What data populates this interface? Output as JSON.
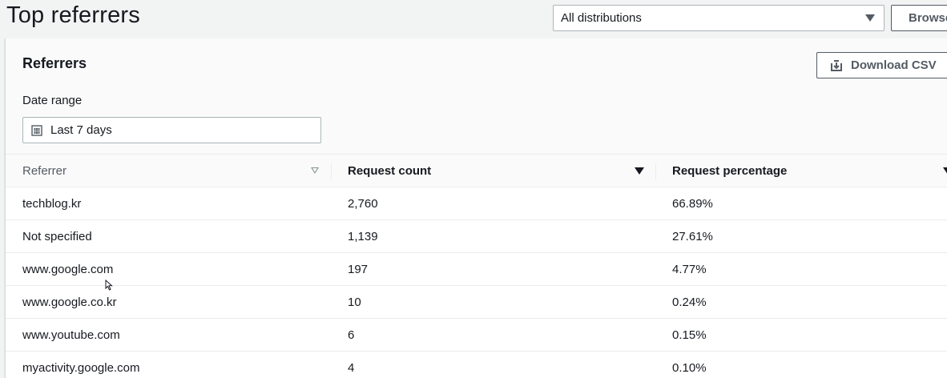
{
  "header": {
    "title": "Top referrers",
    "distribution_select": "All distributions",
    "browse_button": "Browse"
  },
  "panel": {
    "title": "Referrers",
    "download_button": "Download CSV",
    "date_range_label": "Date range",
    "date_range_value": "Last 7 days"
  },
  "table": {
    "columns": [
      "Referrer",
      "Request count",
      "Request percentage"
    ],
    "sorted_column": "Request count",
    "rows": [
      {
        "referrer": "techblog.kr",
        "count": "2,760",
        "percentage": "66.89%"
      },
      {
        "referrer": "Not specified",
        "count": "1,139",
        "percentage": "27.61%"
      },
      {
        "referrer": "www.google.com",
        "count": "197",
        "percentage": "4.77%"
      },
      {
        "referrer": "www.google.co.kr",
        "count": "10",
        "percentage": "0.24%"
      },
      {
        "referrer": "www.youtube.com",
        "count": "6",
        "percentage": "0.15%"
      },
      {
        "referrer": "myactivity.google.com",
        "count": "4",
        "percentage": "0.10%"
      }
    ]
  },
  "icons": [
    "calendar-icon",
    "download-icon",
    "caret-down-icon",
    "sort-icon",
    "mouse-cursor-icon"
  ],
  "colors": {
    "page_background": "#f2f3f3",
    "text": "#16191f",
    "secondary_text": "#545b64",
    "border": "#aab7b8"
  }
}
